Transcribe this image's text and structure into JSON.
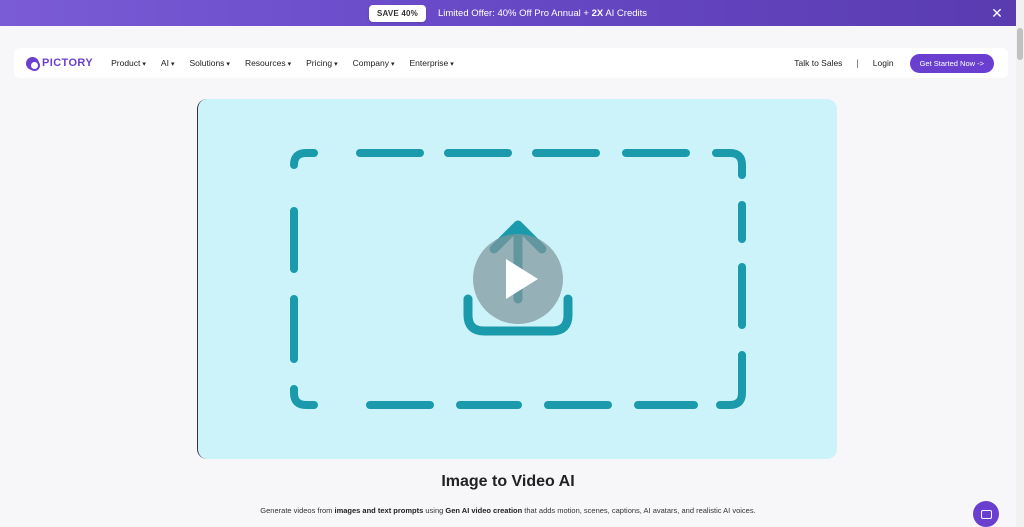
{
  "promo": {
    "badge": "SAVE 40%",
    "text_before": "Limited Offer: 40% Off Pro Annual + ",
    "text_bold": "2X",
    "text_after": " AI Credits",
    "close_icon": "close-icon"
  },
  "nav": {
    "logo": "PICTORY",
    "items": [
      {
        "label": "Product"
      },
      {
        "label": "AI"
      },
      {
        "label": "Solutions"
      },
      {
        "label": "Resources"
      },
      {
        "label": "Pricing"
      },
      {
        "label": "Company"
      },
      {
        "label": "Enterprise"
      }
    ],
    "talk_to_sales": "Talk to Sales",
    "separator": "|",
    "login": "Login",
    "cta": "Get Started Now ->"
  },
  "hero": {
    "background": "#cdf3fa",
    "stroke_color": "#1a9aaa",
    "icon": "upload-icon",
    "play_icon": "play-icon"
  },
  "content": {
    "title": "Image to Video AI",
    "desc_1": "Generate videos from ",
    "desc_bold_1": "images and text prompts",
    "desc_2": " using ",
    "desc_bold_2": "Gen AI video creation",
    "desc_3": " that adds motion, scenes, captions, AI avatars, and realistic AI voices."
  },
  "colors": {
    "brand": "#6a3fd0",
    "banner": "#6a4bc9"
  }
}
